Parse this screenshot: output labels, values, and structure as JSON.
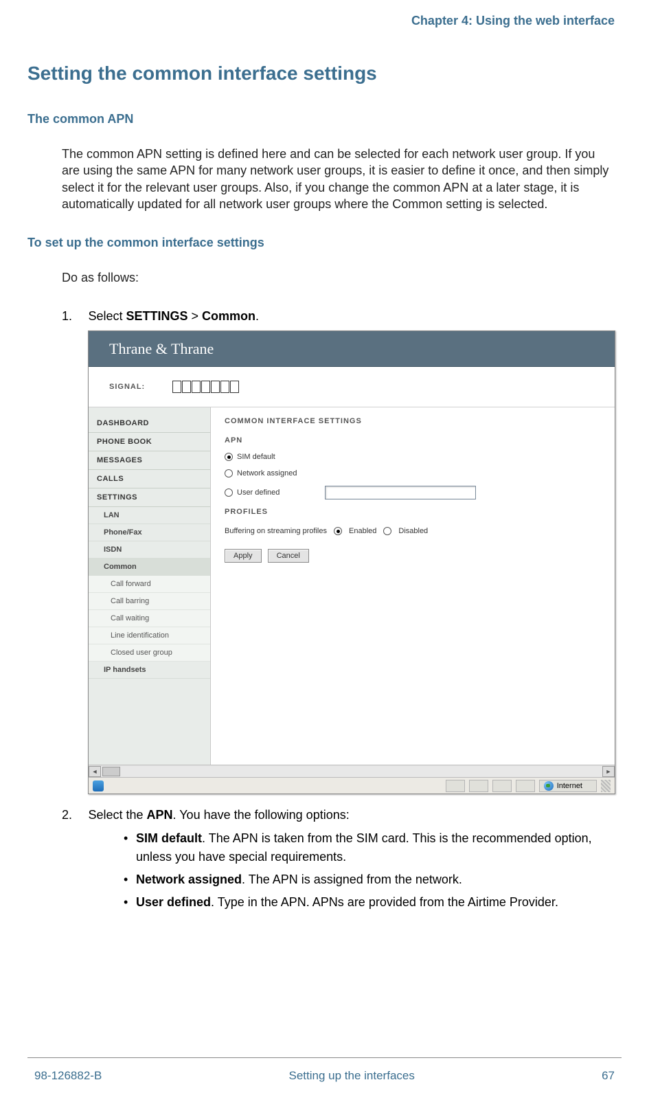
{
  "header": {
    "chapter": "Chapter 4: Using the web interface"
  },
  "h1": "Setting the common interface settings",
  "section1": {
    "title": "The common APN",
    "body": "The common APN setting is defined here and can be selected for each network user group. If you are using the same APN for many network user groups, it is easier to define it once, and then simply select it for the relevant user groups. Also, if you change the common APN at a later stage, it is automatically updated for all network user groups where the Common setting is selected."
  },
  "section2": {
    "title": "To set up the common interface settings",
    "intro": "Do as follows:",
    "step1_no": "1.",
    "step1_pre": "Select ",
    "step1_b1": "SETTINGS",
    "step1_mid": " > ",
    "step1_b2": "Common",
    "step1_post": ".",
    "step2_no": "2.",
    "step2_pre": "Select the ",
    "step2_b": "APN",
    "step2_post": ". You have the following options:",
    "bullets": [
      {
        "b": "SIM default",
        "rest": ". The APN is taken from the SIM card. This is the recommended option, unless you have special requirements."
      },
      {
        "b": "Network assigned",
        "rest": ". The APN is assigned from the network."
      },
      {
        "b": "User defined",
        "rest": ". Type in the APN. APNs are provided from the Airtime Provider."
      }
    ]
  },
  "screenshot": {
    "brand": "Thrane & Thrane",
    "signal_label": "SIGNAL:",
    "sidebar": {
      "top": [
        "DASHBOARD",
        "PHONE BOOK",
        "MESSAGES",
        "CALLS",
        "SETTINGS"
      ],
      "subs": [
        "LAN",
        "Phone/Fax",
        "ISDN",
        "Common"
      ],
      "sub2": [
        "Call forward",
        "Call barring",
        "Call waiting",
        "Line identification",
        "Closed user group"
      ],
      "last": "IP handsets"
    },
    "content": {
      "title": "COMMON INTERFACE SETTINGS",
      "apn_label": "APN",
      "radios": {
        "sim": "SIM default",
        "net": "Network assigned",
        "user": "User defined"
      },
      "profiles_label": "PROFILES",
      "buffering_label": "Buffering on streaming profiles",
      "enabled": "Enabled",
      "disabled": "Disabled",
      "apply": "Apply",
      "cancel": "Cancel"
    },
    "status": {
      "internet": "Internet"
    }
  },
  "footer": {
    "left": "98-126882-B",
    "center": "Setting up the interfaces",
    "right": "67"
  }
}
